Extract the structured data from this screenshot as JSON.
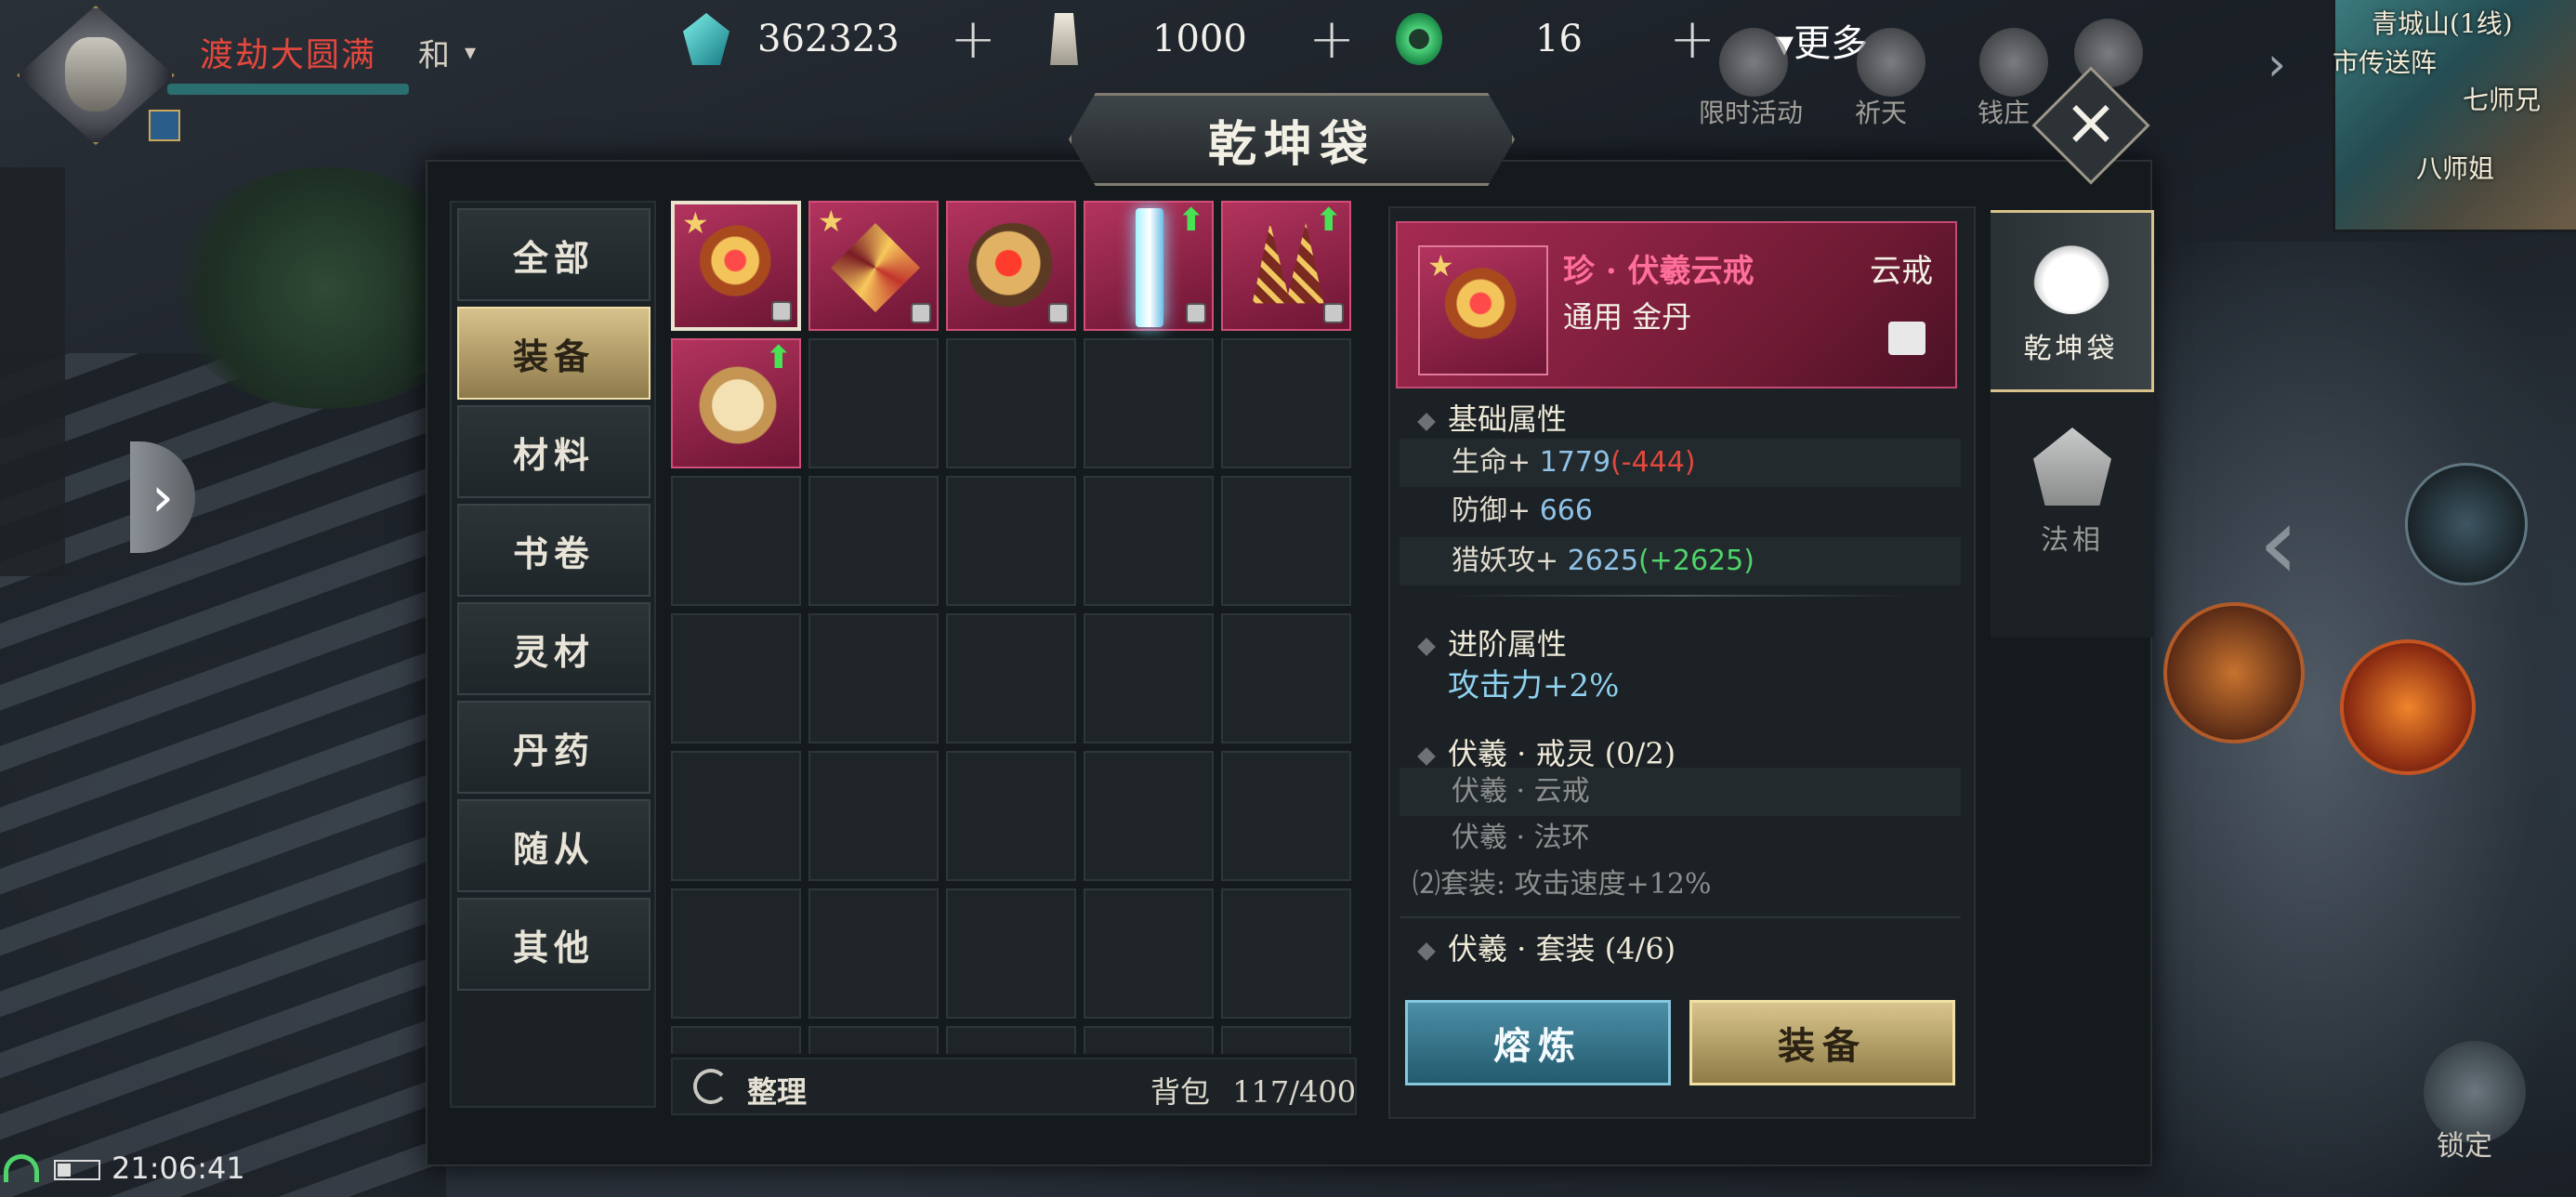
{
  "player": {
    "realm": "渡劫大圆满",
    "stance": "和"
  },
  "currencies": [
    {
      "icon": "spirit-gem-icon",
      "value": "362323"
    },
    {
      "icon": "token-icon",
      "value": "1000"
    },
    {
      "icon": "jade-icon",
      "value": "16"
    }
  ],
  "more_label": "更多",
  "hud_labels": {
    "event": "限时活动",
    "pray": "祈天",
    "shop": "钱庄"
  },
  "minimap": {
    "area": "青城山(1线)",
    "npc1": "市传送阵",
    "npc2": "七师兄",
    "npc3": "八师姐"
  },
  "panel": {
    "title": "乾坤袋",
    "categories": [
      {
        "label": "全部",
        "active": false
      },
      {
        "label": "装备",
        "active": true
      },
      {
        "label": "材料",
        "active": false
      },
      {
        "label": "书卷",
        "active": false
      },
      {
        "label": "灵材",
        "active": false
      },
      {
        "label": "丹药",
        "active": false
      },
      {
        "label": "随从",
        "active": false
      },
      {
        "label": "其他",
        "active": false
      }
    ],
    "sort_label": "整理",
    "bag_label": "背包",
    "bag_count": "117/400"
  },
  "detail": {
    "name": "珍 · 伏羲云戒",
    "type": "云戒",
    "subtitle": "通用  金丹",
    "basic_title": "基础属性",
    "stats": [
      {
        "name": "生命+",
        "value": "1779",
        "delta": "(-444)",
        "delta_kind": "neg"
      },
      {
        "name": "防御+",
        "value": "666",
        "delta": "",
        "delta_kind": ""
      },
      {
        "name": "猎妖攻+",
        "value": "2625",
        "delta": "(+2625)",
        "delta_kind": "pos"
      }
    ],
    "advanced_title": "进阶属性",
    "advanced_value": "攻击力+2%",
    "set1_title": "伏羲 · 戒灵 (0/2)",
    "set1_items": [
      "伏羲 · 云戒",
      "伏羲 · 法环"
    ],
    "set1_bonus": "⑵套装: 攻击速度+12%",
    "set2_title": "伏羲 · 套装 (4/6)"
  },
  "buttons": {
    "smelt": "熔炼",
    "equip": "装备"
  },
  "right_tabs": [
    {
      "label": "乾坤袋",
      "active": true
    },
    {
      "label": "法相",
      "active": false
    }
  ],
  "hud": {
    "lock_label": "锁定"
  },
  "status": {
    "time": "21:06:41"
  },
  "colors": {
    "gold": "#d7c28c",
    "rare_pink": "#b3345e",
    "teal_button": "#4c8fa6"
  }
}
